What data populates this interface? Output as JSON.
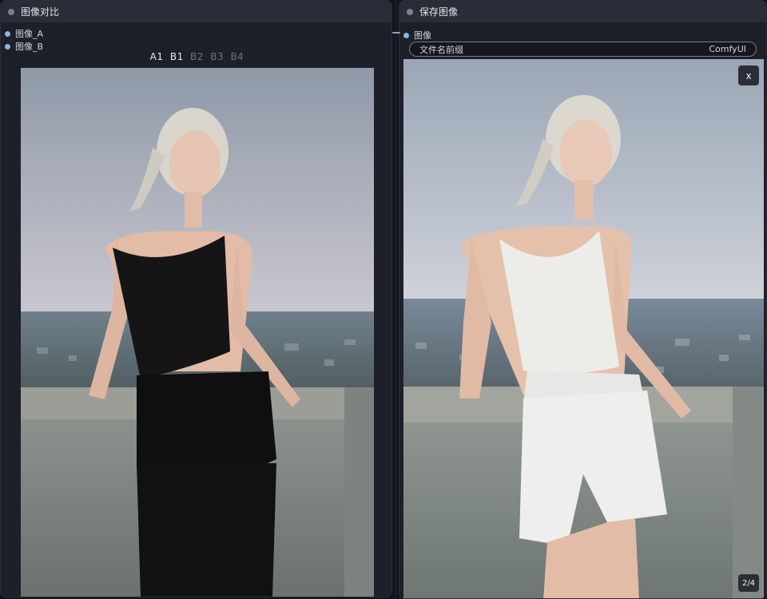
{
  "left_node": {
    "title": "图像对比",
    "inputs": [
      "图像_A",
      "图像_B"
    ],
    "toggles": [
      {
        "label": "A1",
        "active": true
      },
      {
        "label": "B1",
        "active": true
      },
      {
        "label": "B2",
        "active": false
      },
      {
        "label": "B3",
        "active": false
      },
      {
        "label": "B4",
        "active": false
      }
    ]
  },
  "right_node": {
    "title": "保存图像",
    "input_label": "图像",
    "filename_prefix_label": "文件名前缀",
    "filename_prefix_value": "ComfyUI",
    "close_label": "x",
    "page_counter": "2/4"
  },
  "colors": {
    "node_bg": "#222530",
    "header_bg": "#2a2d37",
    "port": "#8fb6dd",
    "link": "#7aa7d6"
  }
}
